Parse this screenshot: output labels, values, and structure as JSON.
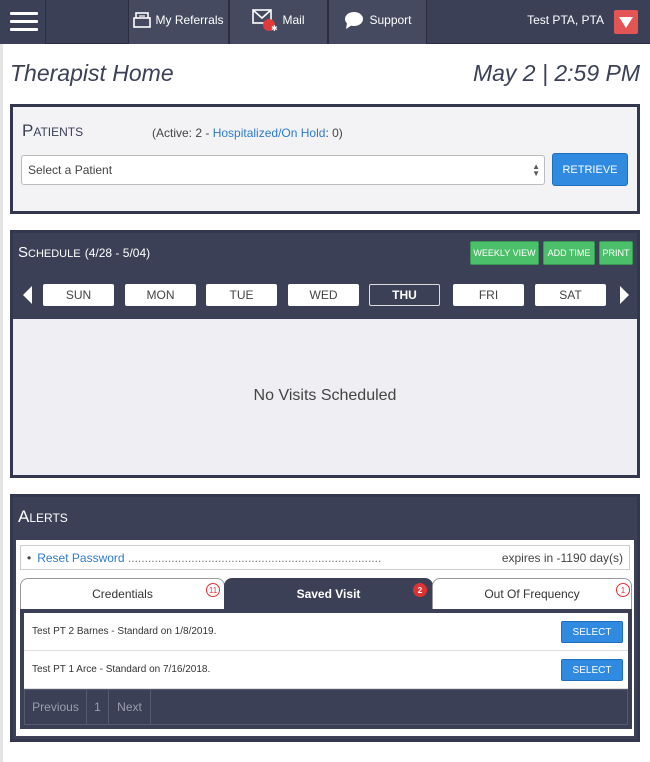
{
  "nav": {
    "items": [
      {
        "label": "My Referrals",
        "icon": "referrals-icon"
      },
      {
        "label": "Mail",
        "icon": "mail-icon"
      },
      {
        "label": "Support",
        "icon": "support-icon"
      }
    ],
    "user": "Test PTA, PTA",
    "mail_alert_glyph": "✱"
  },
  "page": {
    "title": "Therapist Home",
    "datetime": "May 2 | 2:59 PM"
  },
  "patients": {
    "title": "Patients",
    "active_label": "(Active: 2 -",
    "hospitalized_link": "Hospitalized/On Hold",
    "hospitalized_count": ": 0)",
    "select_placeholder": "Select a Patient",
    "retrieve_label": "RETRIEVE"
  },
  "schedule": {
    "title": "Schedule",
    "range": "(4/28 - 5/04)",
    "buttons": [
      "WEEKLY VIEW",
      "ADD TIME",
      "PRINT"
    ],
    "days": [
      "SUN",
      "MON",
      "TUE",
      "WED",
      "THU",
      "FRI",
      "SAT"
    ],
    "active_day": "THU",
    "empty_message": "No Visits Scheduled"
  },
  "alerts": {
    "title": "Alerts",
    "items": [
      {
        "link": "Reset Password",
        "dots": "............................................................................",
        "status": "expires in -1190 day(s)"
      }
    ],
    "tabs": [
      {
        "label": "Credentials",
        "badge": "11"
      },
      {
        "label": "Saved Visit",
        "badge": "2"
      },
      {
        "label": "Out Of Frequency",
        "badge": "1"
      }
    ],
    "active_tab": "Saved Visit",
    "rows": [
      {
        "text": "Test PT 2 Barnes - Standard on 1/8/2019.",
        "action": "SELECT"
      },
      {
        "text": "Test PT 1 Arce - Standard on 7/16/2018.",
        "action": "SELECT"
      }
    ],
    "pager": {
      "previous": "Previous",
      "page": "1",
      "next": "Next"
    }
  },
  "colors": {
    "navy": "#3b4056",
    "primary": "#2f8ae0",
    "green": "#4cbf6a",
    "danger": "#e35555"
  }
}
